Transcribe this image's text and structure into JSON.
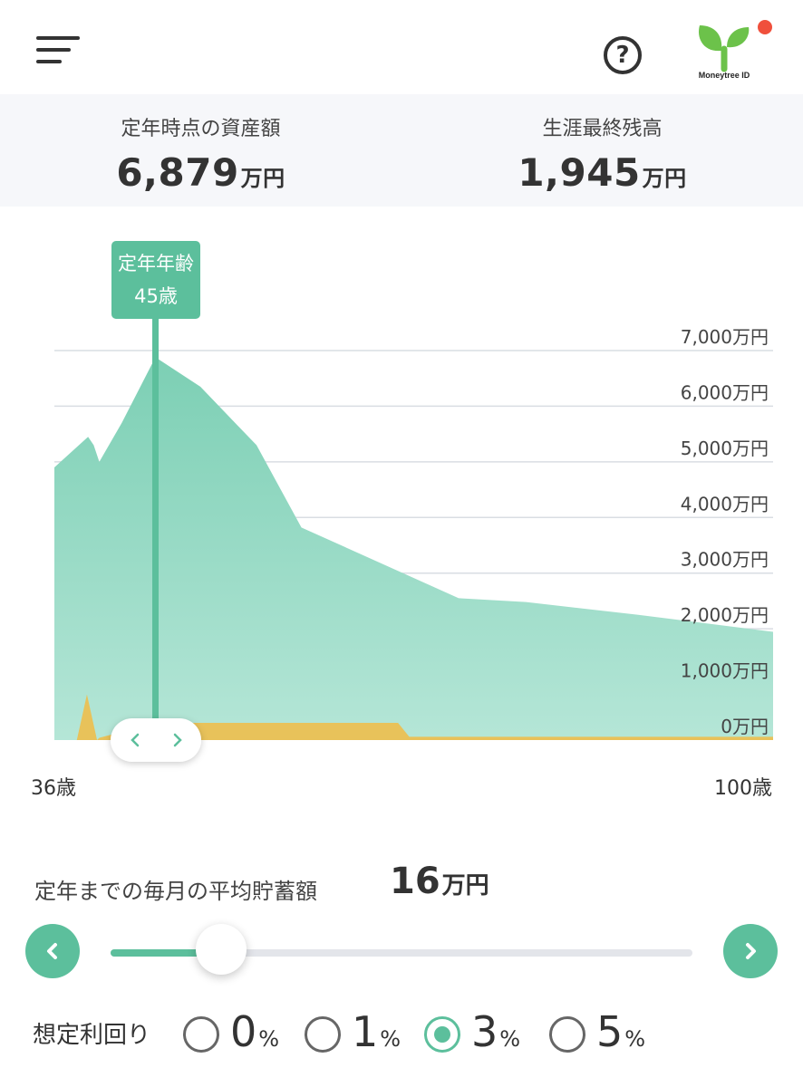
{
  "header": {
    "help_glyph": "?",
    "logo_text": "Moneytree ID",
    "colors": {
      "logo_green": "#6cc24a",
      "notify": "#f0503c"
    }
  },
  "summary": {
    "retirement_assets": {
      "label": "定年時点の資産額",
      "value": "6,879",
      "unit": "万円"
    },
    "final_balance": {
      "label": "生涯最終残高",
      "value": "1,945",
      "unit": "万円"
    }
  },
  "chart": {
    "marker": {
      "line1": "定年年齢",
      "line2": "45歳"
    },
    "age_start": "36歳",
    "age_end": "100歳",
    "y_ticks": [
      "7,000万円",
      "6,000万円",
      "5,000万円",
      "4,000万円",
      "3,000万円",
      "2,000万円",
      "1,000万円",
      "0万円"
    ]
  },
  "chart_data": {
    "type": "area",
    "x_range": [
      36,
      100
    ],
    "ylim": [
      0,
      7000
    ],
    "grid": true,
    "marker_age": 45,
    "colors": {
      "assets": "#8dd3bd",
      "income": "#e8c25a",
      "marker": "#5cbf9c"
    },
    "series": [
      {
        "x": [
          36,
          39,
          39.5,
          40,
          42,
          45,
          49,
          54,
          58,
          72,
          78,
          88,
          100
        ],
        "values": [
          4900,
          5450,
          5300,
          5000,
          5700,
          6879,
          6350,
          5300,
          3820,
          2550,
          2480,
          2250,
          1945
        ]
      },
      {
        "x": [
          38,
          38.9,
          39.8,
          40,
          45,
          46,
          66.6,
          67.6,
          100
        ],
        "values": [
          0,
          820,
          0,
          40,
          310,
          310,
          310,
          60,
          60
        ]
      }
    ]
  },
  "savings": {
    "label": "定年までの毎月の平均貯蓄額",
    "value": "16",
    "unit": "万円",
    "slider_fraction": 0.19
  },
  "rates": {
    "label": "想定利回り",
    "options": [
      {
        "value": "0",
        "unit": "%",
        "selected": false
      },
      {
        "value": "1",
        "unit": "%",
        "selected": false
      },
      {
        "value": "3",
        "unit": "%",
        "selected": true
      },
      {
        "value": "5",
        "unit": "%",
        "selected": false
      }
    ]
  }
}
